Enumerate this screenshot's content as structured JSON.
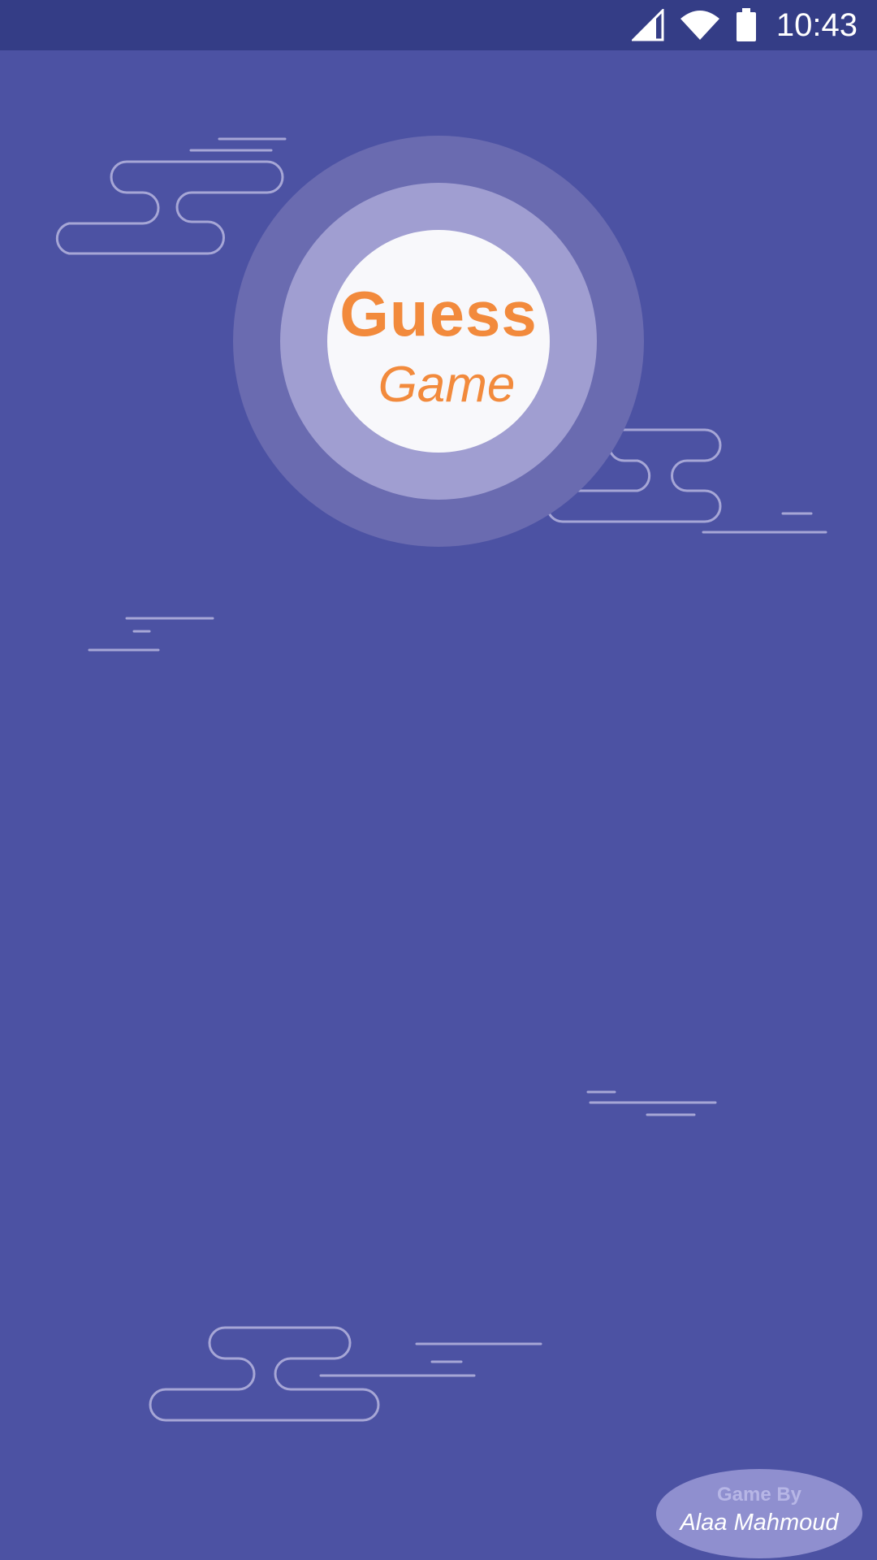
{
  "status_bar": {
    "time": "10:43",
    "icons": [
      "signal-icon",
      "wifi-icon",
      "battery-icon"
    ]
  },
  "logo": {
    "title": "Guess",
    "subtitle": "Game"
  },
  "credit": {
    "label": "Game By",
    "author": "Alaa Mahmoud"
  },
  "colors": {
    "background": "#4c52a3",
    "status_bar": "#343d86",
    "accent": "#f28a3c",
    "logo_outer_ring": "#6a6bb0",
    "logo_middle_ring": "#a09ed1",
    "logo_center": "#f8f8fb",
    "credit_badge": "#8f8fcf"
  }
}
